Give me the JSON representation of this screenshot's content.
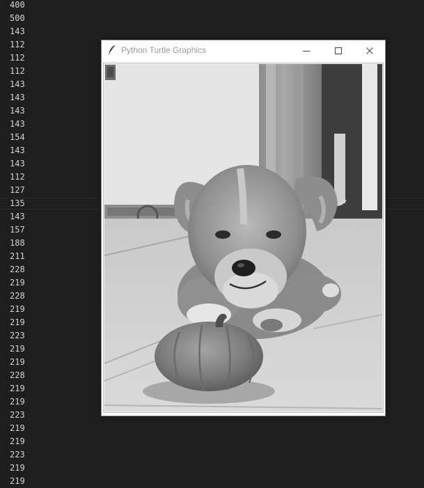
{
  "editor": {
    "lines": [
      "400",
      "500",
      "143",
      "112",
      "112",
      "112",
      "143",
      "143",
      "143",
      "143",
      "154",
      "143",
      "143",
      "112",
      "127",
      "135",
      "143",
      "157",
      "188",
      "211",
      "228",
      "219",
      "228",
      "219",
      "219",
      "223",
      "219",
      "219",
      "228",
      "219",
      "219",
      "223",
      "219",
      "219",
      "223",
      "219",
      "219"
    ],
    "current_line_index": 15
  },
  "window": {
    "title": "Python Turtle Graphics",
    "icons": {
      "app": "feather-icon",
      "minimize": "minimize-icon",
      "maximize": "maximize-icon",
      "close": "close-icon"
    }
  },
  "canvas": {
    "content": "grayscale-photo-puppy-with-pumpkin"
  }
}
